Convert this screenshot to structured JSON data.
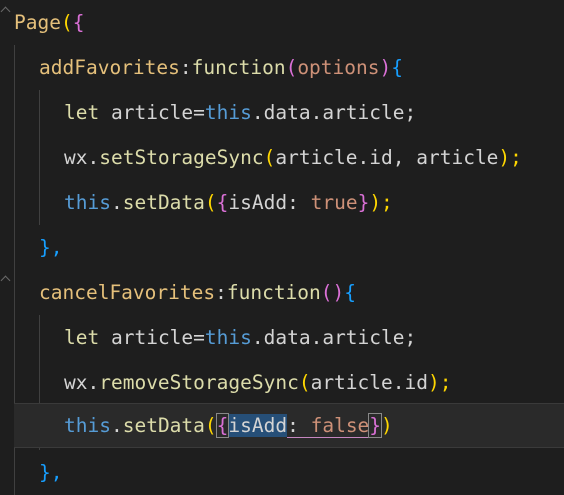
{
  "editor": {
    "lines": [
      {
        "id": "l1"
      },
      {
        "id": "l2"
      }
    ],
    "tokens": {
      "page": "Page",
      "paren_open": "(",
      "brace_open": "{",
      "addFavorites": "addFavorites",
      "colon": ":",
      "function_kw": "function",
      "options": "options",
      "paren_close": ")",
      "let_kw": "let",
      "article_var": "article",
      "eq": "=",
      "this_kw": "this",
      "dot_data_article": ".data.article;",
      "wx": "wx",
      "dot": ".",
      "setStorageSync": "setStorageSync",
      "args_set": "article.id, article",
      "close_semi": ");",
      "setData": "setData",
      "isAdd": "isAdd",
      "colon_space": ": ",
      "true_val": "true",
      "brace_close": "}",
      "close_brace_comma": "},",
      "cancelFavorites": "cancelFavorites",
      "empty_parens": "()",
      "removeStorageSync": "removeStorageSync",
      "args_remove": "article.id",
      "false_val": "false",
      "paren_close_only": ")"
    }
  }
}
